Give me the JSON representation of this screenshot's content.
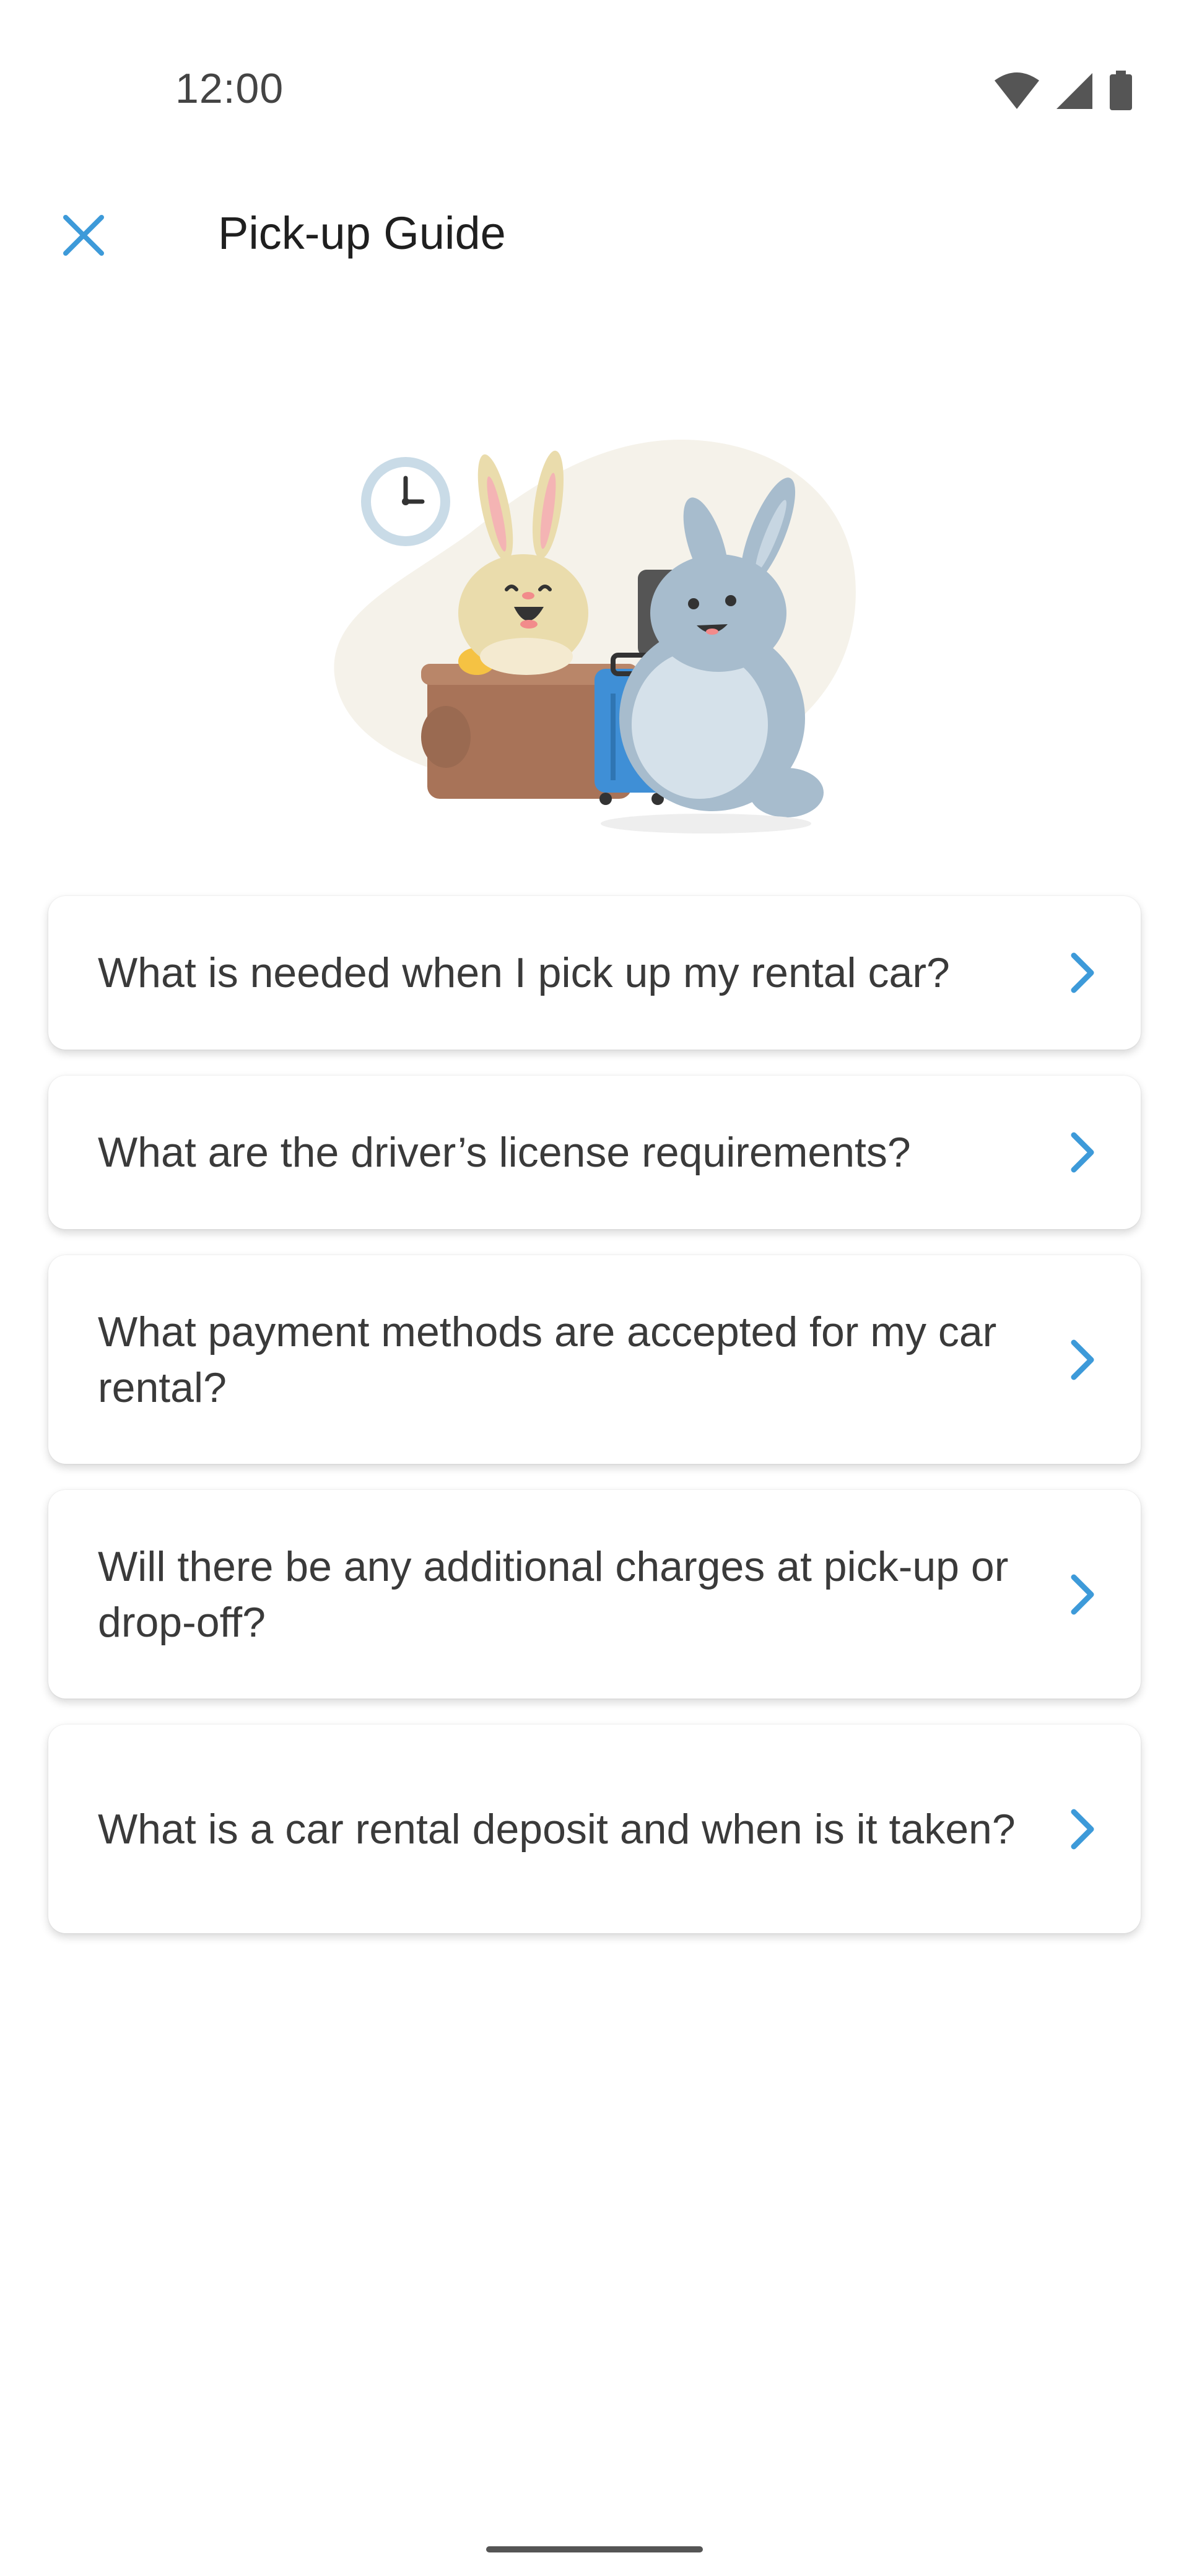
{
  "status_bar": {
    "time": "12:00",
    "icons": [
      "wifi-icon",
      "signal-icon",
      "battery-icon"
    ]
  },
  "app_bar": {
    "close_icon": "close-icon",
    "title": "Pick-up Guide"
  },
  "illustration": {
    "description_icon": "rental-desk-bunnies-illustration"
  },
  "faq": [
    {
      "question": "What is needed when I pick up my rental car?",
      "icon": "chevron-right-icon"
    },
    {
      "question": "What are the driver’s license requirements?",
      "icon": "chevron-right-icon"
    },
    {
      "question": "What payment methods are accepted for my car rental?",
      "icon": "chevron-right-icon"
    },
    {
      "question": "Will there be any additional charges at pick-up or drop-off?",
      "icon": "chevron-right-icon"
    },
    {
      "question": "What is a car rental deposit and when is it taken?",
      "icon": "chevron-right-icon"
    }
  ],
  "colors": {
    "accent": "#3d9ad9",
    "text": "#3a3a3a",
    "title": "#1f1f1f"
  }
}
